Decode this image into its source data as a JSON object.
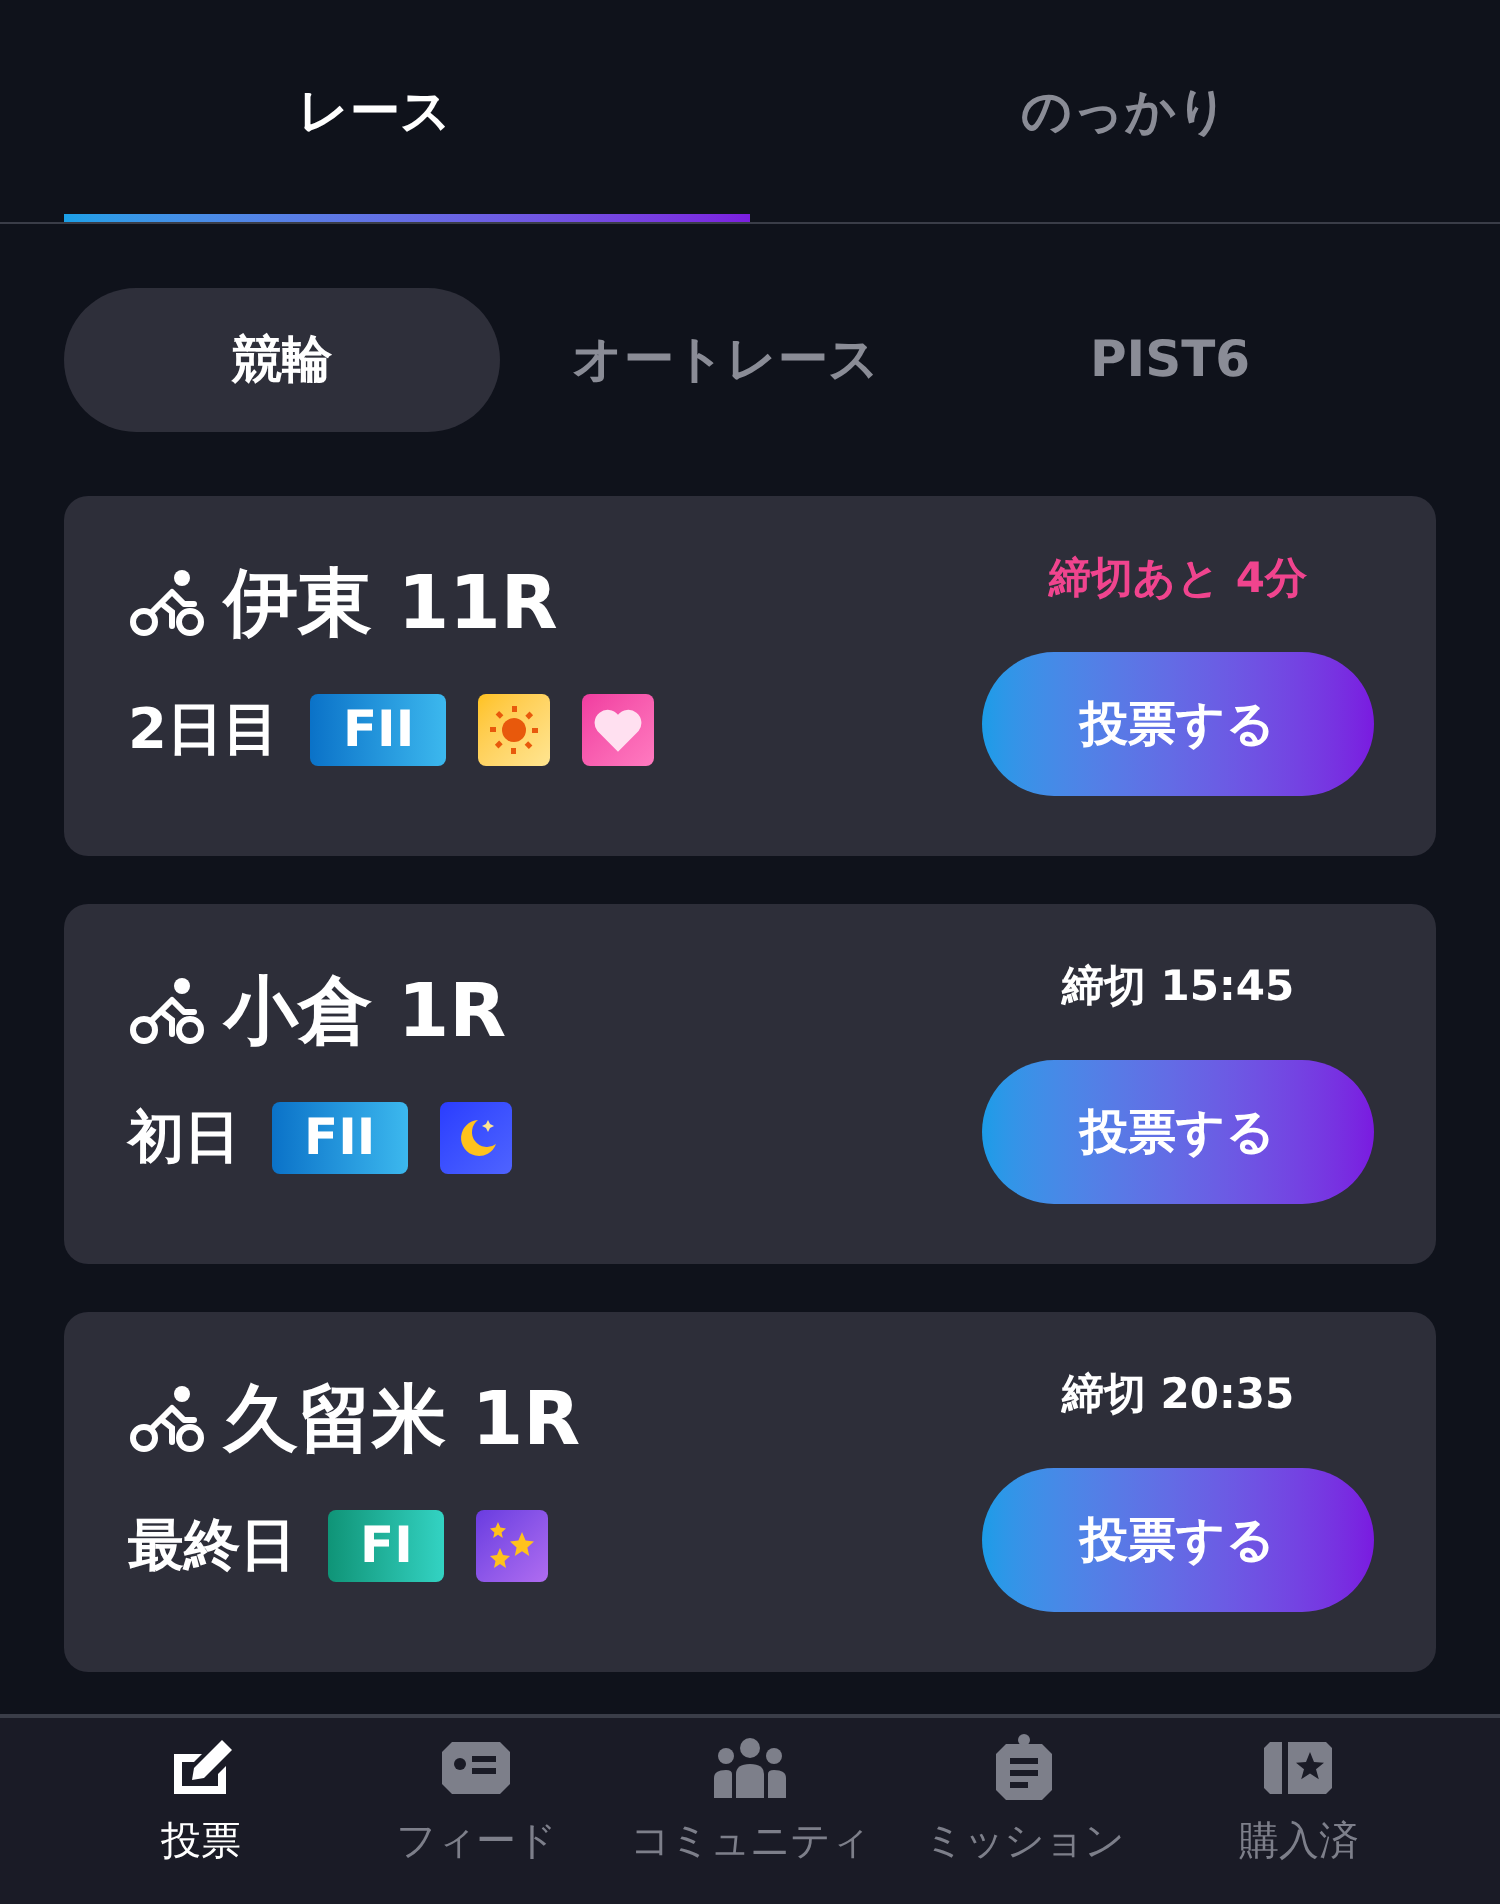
{
  "top_tabs": [
    {
      "label": "レース",
      "selected": true
    },
    {
      "label": "のっかり",
      "selected": false
    }
  ],
  "segments": [
    {
      "label": "競輪",
      "selected": true
    },
    {
      "label": "オートレース",
      "selected": false
    },
    {
      "label": "PIST6",
      "selected": false
    }
  ],
  "races": [
    {
      "title": "伊東 11R",
      "day": "2日目",
      "grade": {
        "label": "FII",
        "kind": "fii"
      },
      "icons": [
        {
          "kind": "sun"
        },
        {
          "kind": "heart"
        }
      ],
      "deadline": "締切あと 4分",
      "urgent": true,
      "button": "投票する"
    },
    {
      "title": "小倉 1R",
      "day": "初日",
      "grade": {
        "label": "FII",
        "kind": "fii"
      },
      "icons": [
        {
          "kind": "moon"
        }
      ],
      "deadline": "締切 15:45",
      "urgent": false,
      "button": "投票する"
    },
    {
      "title": "久留米 1R",
      "day": "最終日",
      "grade": {
        "label": "FI",
        "kind": "fi"
      },
      "icons": [
        {
          "kind": "stars"
        }
      ],
      "deadline": "締切 20:35",
      "urgent": false,
      "button": "投票する"
    }
  ],
  "bottom_nav": [
    {
      "label": "投票",
      "kind": "vote",
      "selected": true
    },
    {
      "label": "フィード",
      "kind": "feed",
      "selected": false
    },
    {
      "label": "コミュニティ",
      "kind": "community",
      "selected": false
    },
    {
      "label": "ミッション",
      "kind": "mission",
      "selected": false
    },
    {
      "label": "購入済",
      "kind": "purchased",
      "selected": false
    }
  ]
}
